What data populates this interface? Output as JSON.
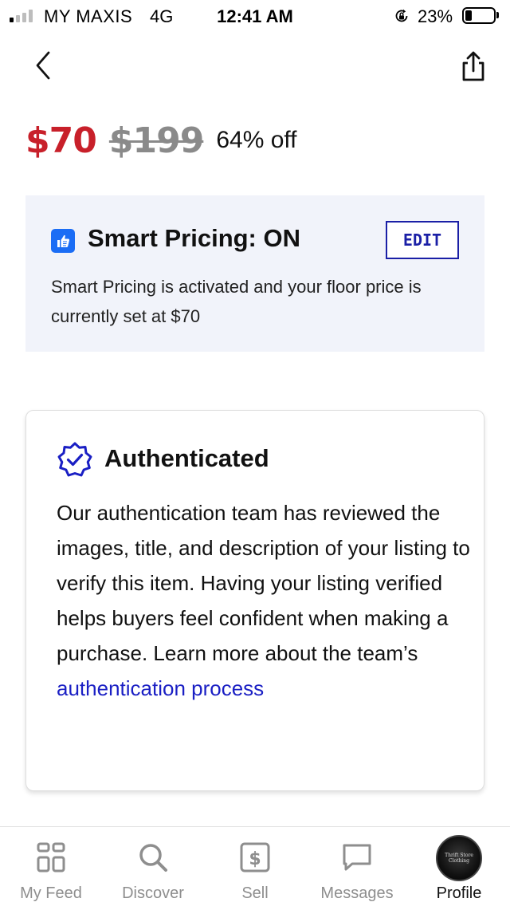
{
  "status_bar": {
    "carrier": "MY MAXIS",
    "network": "4G",
    "time": "12:41 AM",
    "battery_percent_label": "23%",
    "battery_level": 0.23,
    "signal_bars_filled": 1,
    "signal_bars_total": 4
  },
  "nav": {
    "back_icon": "chevron-left-icon",
    "share_icon": "share-icon"
  },
  "price": {
    "current": "$70",
    "original": "$199",
    "discount": "64% off",
    "current_color": "#c8202a",
    "original_color": "#8a8a8a"
  },
  "smart_pricing": {
    "icon": "thumbs-up-icon",
    "title": "Smart Pricing: ON",
    "edit_label": "EDIT",
    "description": "Smart Pricing is activated and your floor price is currently set at $70",
    "background_color": "#f1f3fa",
    "accent_color": "#1a1fa6"
  },
  "authenticated": {
    "icon": "verified-badge-icon",
    "title": "Authenticated",
    "body": "Our authentication team has reviewed the images, title, and description of your listing to verify this item. Having your listing verified helps buyers feel confident when making a purchase. Learn more about the team’s",
    "link_text": "authentication process",
    "link_color": "#1a1fc4"
  },
  "tab_bar": {
    "tabs": [
      {
        "label": "My Feed",
        "icon": "feed-grid-icon",
        "active": false
      },
      {
        "label": "Discover",
        "icon": "search-icon",
        "active": false
      },
      {
        "label": "Sell",
        "icon": "dollar-tag-icon",
        "active": false
      },
      {
        "label": "Messages",
        "icon": "chat-bubble-icon",
        "active": false
      },
      {
        "label": "Profile",
        "icon": "avatar",
        "active": true
      }
    ],
    "avatar_text": "Thrift Store Clothing"
  }
}
